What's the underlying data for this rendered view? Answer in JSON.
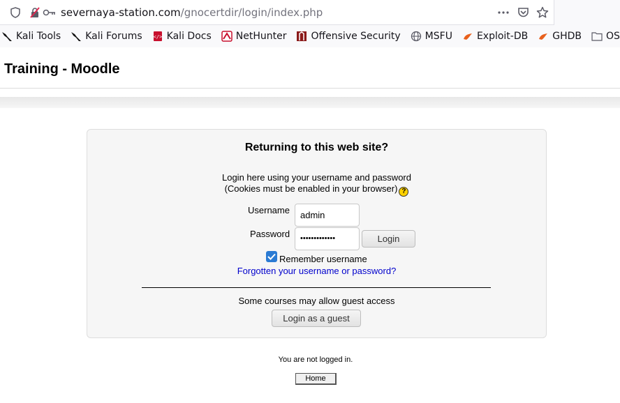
{
  "browser": {
    "url_host": "severnaya-station.com",
    "url_path": "/gnocertdir/login/index.php",
    "icons": [
      "shield-icon",
      "insecure-connection-icon",
      "key-icon",
      "more-actions-icon",
      "pocket-icon",
      "bookmark-star-icon"
    ]
  },
  "bookmarks": [
    {
      "label": "Kali Tools",
      "icon": "kali-dragon-icon"
    },
    {
      "label": "Kali Forums",
      "icon": "kali-dragon-icon"
    },
    {
      "label": "Kali Docs",
      "icon": "kali-docs-icon"
    },
    {
      "label": "NetHunter",
      "icon": "nethunter-icon"
    },
    {
      "label": "Offensive Security",
      "icon": "offsec-icon"
    },
    {
      "label": "MSFU",
      "icon": "globe-icon"
    },
    {
      "label": "Exploit-DB",
      "icon": "exploitdb-icon"
    },
    {
      "label": "GHDB",
      "icon": "exploitdb-icon"
    },
    {
      "label": "OSCP",
      "icon": "folder-icon"
    }
  ],
  "page": {
    "site_title": "Training - Moodle"
  },
  "login": {
    "heading": "Returning to this web site?",
    "desc_line1": "Login here using your username and password",
    "desc_line2": "(Cookies must be enabled in your browser)",
    "username_label": "Username",
    "username_value": "admin",
    "password_label": "Password",
    "password_value": "•••••••••••••",
    "login_button": "Login",
    "remember_label": "Remember username",
    "remember_checked": true,
    "forgot_link": "Forgotten your username or password?",
    "guest_text": "Some courses may allow guest access",
    "guest_button": "Login as a guest"
  },
  "footer": {
    "status_text": "You are not logged in.",
    "home_button": "Home"
  },
  "colors": {
    "link": "#0000cc",
    "checkbox": "#2b7bd3",
    "help_icon": "#ffd200"
  }
}
